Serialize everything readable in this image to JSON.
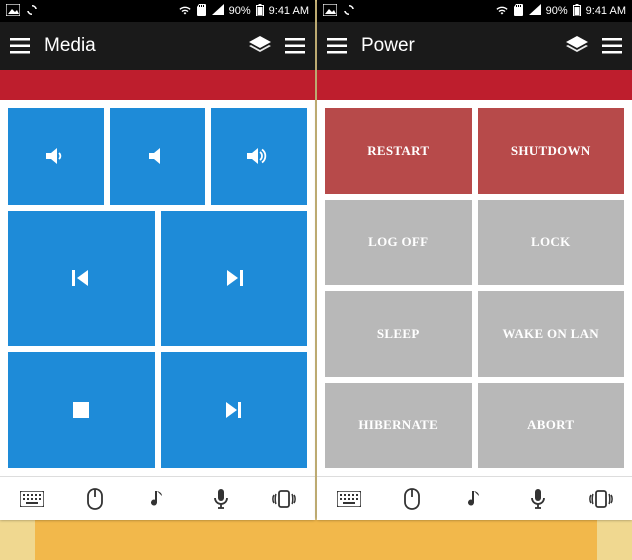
{
  "statusbar": {
    "battery_pct": "90%",
    "time": "9:41 AM"
  },
  "screens": {
    "left": {
      "title": "Media",
      "tiles": [
        {
          "name": "volume-down",
          "icon": "vol-low"
        },
        {
          "name": "volume-mute",
          "icon": "vol-mute"
        },
        {
          "name": "volume-up",
          "icon": "vol-high"
        },
        {
          "name": "previous-track",
          "icon": "prev"
        },
        {
          "name": "next-track",
          "icon": "next"
        },
        {
          "name": "stop",
          "icon": "stop"
        },
        {
          "name": "play-step",
          "icon": "play-step"
        }
      ]
    },
    "right": {
      "title": "Power",
      "buttons": [
        {
          "label": "RESTART",
          "color": "red"
        },
        {
          "label": "SHUTDOWN",
          "color": "red"
        },
        {
          "label": "LOG OFF",
          "color": "gray"
        },
        {
          "label": "LOCK",
          "color": "gray"
        },
        {
          "label": "SLEEP",
          "color": "gray"
        },
        {
          "label": "WAKE ON LAN",
          "color": "gray"
        },
        {
          "label": "HIBERNATE",
          "color": "gray"
        },
        {
          "label": "ABORT",
          "color": "gray"
        }
      ]
    }
  },
  "bottombar_icons": [
    "keyboard",
    "mouse",
    "music",
    "mic",
    "vibrate"
  ]
}
